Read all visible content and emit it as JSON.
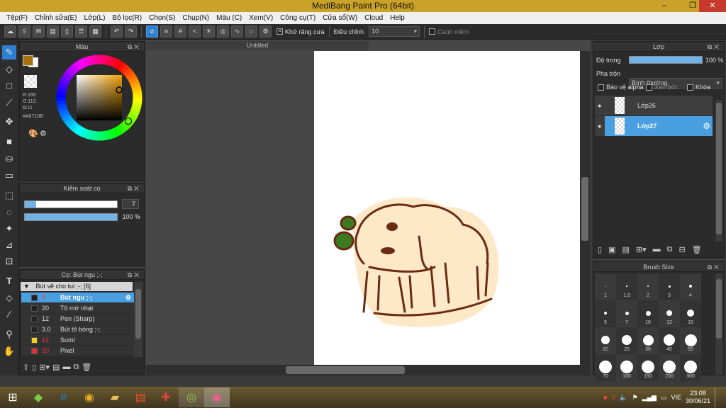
{
  "window": {
    "title": "MediBang Paint Pro (64bit)",
    "min_icon": "minimize-icon",
    "max_icon": "restore-icon",
    "close_icon": "close-icon"
  },
  "menu": [
    "Tệp(F)",
    "Chỉnh sửa(E)",
    "Lớp(L)",
    "Bộ lọc(R)",
    "Chọn(S)",
    "Chụp(N)",
    "Màu (C)",
    "Xem(V)",
    "Công cụ(T)",
    "Cửa sổ(W)",
    "Cloud",
    "Help"
  ],
  "toolbar": {
    "antialias_label": "Khử răng cưa",
    "adjust_label": "Điều chỉnh",
    "adjust_value": "10",
    "edge_label": "Canh mềm"
  },
  "color_panel": {
    "title": "Màu",
    "r": "R:166",
    "g": "G:113",
    "b": "B:11",
    "hex": "#A6710B",
    "fg_color": "#a6710b",
    "bg_color": "#ffffff"
  },
  "brush_control": {
    "title": "Kiểm soát cọ",
    "size_value": "7",
    "opacity_value": "100 %",
    "size_fraction": 0.12,
    "opacity_fraction": 1.0
  },
  "brush_panel": {
    "title": "Cọ: Bút ngu ;-;",
    "group": "Bút vẽ cho tui ;-; [6]",
    "items": [
      {
        "size": "7",
        "name": "Bút ngu ;-;",
        "color": "#222222",
        "selected": true
      },
      {
        "size": "20",
        "name": "Tô mờ nhạt",
        "color": "#222222",
        "selected": false
      },
      {
        "size": "12",
        "name": "Pen (Sharp)",
        "color": "#222222",
        "selected": false
      },
      {
        "size": "3.0",
        "name": "Bút tô bóng ;-;",
        "color": "#222222",
        "selected": false
      },
      {
        "size": "12",
        "name": "Sumi",
        "color": "#f2d21c",
        "selected": false
      },
      {
        "size": "20",
        "name": "Pixel",
        "color": "#e03030",
        "selected": false
      }
    ]
  },
  "canvas": {
    "tab_title": "Untitled"
  },
  "layer_panel": {
    "title": "Lớp",
    "opacity_label": "Độ trong",
    "opacity_value": "100 %",
    "blend_label": "Pha trộn",
    "blend_value": "Bình thường",
    "protect_alpha": "Bảo vệ alpha",
    "clip": "Xén bớt",
    "lock": "Khóa",
    "layers": [
      {
        "name": "Lớp26",
        "selected": false
      },
      {
        "name": "Lớp27",
        "selected": true
      }
    ]
  },
  "brush_size_panel": {
    "title": "Brush Size",
    "sizes": [
      "1",
      "1.5",
      "2",
      "3",
      "4",
      "5",
      "7",
      "10",
      "12",
      "15",
      "20",
      "25",
      "30",
      "40",
      "50",
      "70",
      "100",
      "150",
      "200",
      "300"
    ]
  },
  "taskbar": {
    "lang": "VIE",
    "time": "23:08",
    "date": "30/06/21"
  },
  "colors": {
    "accent": "#2d7fd0",
    "titlebar": "#c9a227",
    "panel": "#2b2b2b"
  }
}
